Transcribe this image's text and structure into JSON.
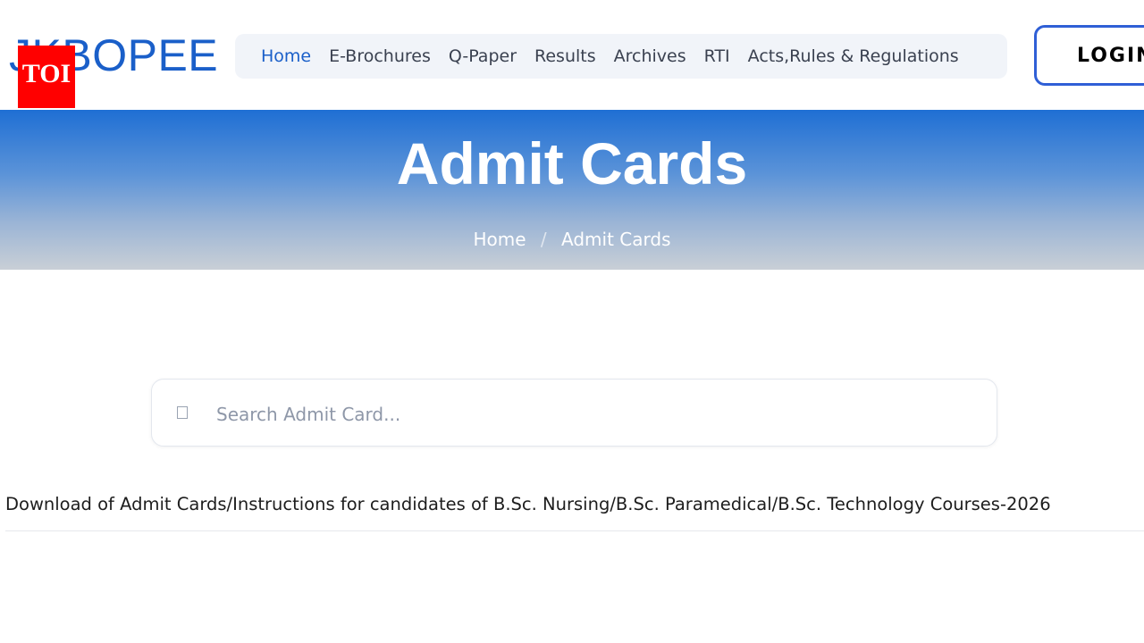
{
  "header": {
    "logo_text": "JKBOPEE",
    "watermark": "TOI",
    "nav": [
      {
        "label": "Home"
      },
      {
        "label": "E-Brochures"
      },
      {
        "label": "Q-Paper"
      },
      {
        "label": "Results"
      },
      {
        "label": "Archives"
      },
      {
        "label": "RTI"
      },
      {
        "label": "Acts,Rules & Regulations"
      }
    ],
    "login_label": "LOGIN",
    "accent_color": "#1a5fc9"
  },
  "banner": {
    "title": "Admit Cards",
    "breadcrumb": {
      "home": "Home",
      "separator": "/",
      "current": "Admit Cards"
    }
  },
  "search": {
    "placeholder": "Search Admit Card...",
    "value": ""
  },
  "items": [
    {
      "title": "Download of Admit Cards/Instructions for candidates of B.Sc. Nursing/B.Sc. Paramedical/B.Sc. Technology Courses-2026"
    }
  ]
}
